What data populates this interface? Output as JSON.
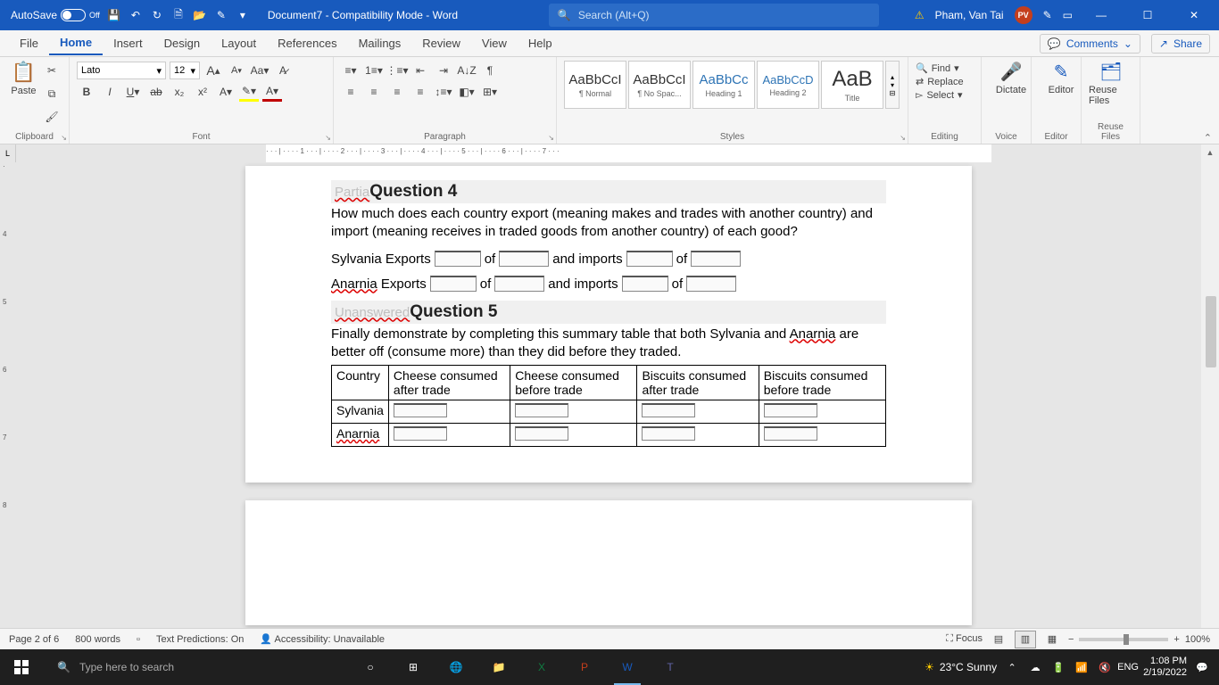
{
  "titlebar": {
    "autosave_label": "AutoSave",
    "autosave_state": "Off",
    "doc_title": "Document7  -  Compatibility Mode  -  Word",
    "search_placeholder": "Search (Alt+Q)",
    "user_name": "Pham, Van Tai",
    "user_initials": "PV"
  },
  "menu": {
    "items": [
      "File",
      "Home",
      "Insert",
      "Design",
      "Layout",
      "References",
      "Mailings",
      "Review",
      "View",
      "Help"
    ],
    "active": "Home",
    "comments": "Comments",
    "share": "Share"
  },
  "ribbon": {
    "clipboard_label": "Clipboard",
    "paste_label": "Paste",
    "font_label": "Font",
    "font_name": "Lato",
    "font_size": "12",
    "paragraph_label": "Paragraph",
    "styles_label": "Styles",
    "styles": [
      {
        "preview": "AaBbCcI",
        "name": "¶ Normal"
      },
      {
        "preview": "AaBbCcI",
        "name": "¶ No Spac..."
      },
      {
        "preview": "AaBbCc",
        "name": "Heading 1"
      },
      {
        "preview": "AaBbCcD",
        "name": "Heading 2"
      },
      {
        "preview": "AaB",
        "name": "Title"
      }
    ],
    "editing_label": "Editing",
    "find": "Find",
    "replace": "Replace",
    "select": "Select",
    "voice_label": "Voice",
    "dictate": "Dictate",
    "editor_label": "Editor",
    "editor": "Editor",
    "reuse_label": "Reuse Files",
    "reuse": "Reuse Files"
  },
  "document": {
    "q4": {
      "ghost_prefix": "Partia",
      "title": "Question 4",
      "text": "How much does each country export (meaning makes and trades with another country) and import (meaning receives in traded goods from another country) of each good?",
      "line1_a": "Sylvania Exports",
      "line1_b": "of",
      "line1_c": "and imports",
      "line1_d": "of",
      "line2_a": "Anarnia",
      "line2_a2": " Exports",
      "line2_b": "of",
      "line2_c": "and imports",
      "line2_d": "of"
    },
    "q5": {
      "ghost_prefix": "Unanswered",
      "title": "Question 5",
      "text_a": "Finally demonstrate by completing this summary table that both Sylvania and ",
      "text_b": "Anarnia",
      "text_c": " are better off (consume more) than they did before they traded.",
      "headers": [
        "Country",
        "Cheese consumed after trade",
        "Cheese consumed before trade",
        "Biscuits consumed after trade",
        "Biscuits consumed before trade"
      ],
      "rows": [
        "Sylvania",
        "Anarnia"
      ]
    }
  },
  "statusbar": {
    "page": "Page 2 of 6",
    "words": "800 words",
    "predictions": "Text Predictions: On",
    "accessibility": "Accessibility: Unavailable",
    "focus": "Focus",
    "zoom": "100%"
  },
  "taskbar": {
    "search_placeholder": "Type here to search",
    "weather": "23°C  Sunny",
    "lang": "ENG",
    "time": "1:08 PM",
    "date": "2/19/2022"
  }
}
